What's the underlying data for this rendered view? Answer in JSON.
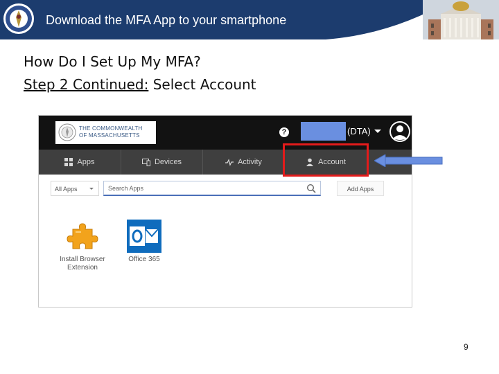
{
  "header": {
    "title": "Download the MFA App to your smartphone"
  },
  "heading": "How Do I Set Up My MFA?",
  "step": {
    "underlined": "Step 2 Continued:",
    "rest": " Select Account"
  },
  "screenshot": {
    "logo_line1": "THE COMMONWEALTH",
    "logo_line2": "OF MASSACHUSETTS",
    "help": "?",
    "user_suffix": "(DTA)",
    "nav": [
      {
        "label": "Apps",
        "icon": "grid-icon"
      },
      {
        "label": "Devices",
        "icon": "devices-icon"
      },
      {
        "label": "Activity",
        "icon": "pulse-icon"
      },
      {
        "label": "Account",
        "icon": "person-icon"
      }
    ],
    "filter": "All Apps",
    "search_placeholder": "Search Apps",
    "add_apps": "Add Apps",
    "tiles": [
      {
        "label_line1": "Install Browser",
        "label_line2": "Extension",
        "icon": "puzzle-icon"
      },
      {
        "label_line1": "Office 365",
        "label_line2": "",
        "icon": "outlook-icon"
      }
    ]
  },
  "page_number": "9",
  "colors": {
    "header_bg": "#1c3c6e",
    "highlight": "#e31b1b",
    "arrow": "#6a8fe0"
  }
}
